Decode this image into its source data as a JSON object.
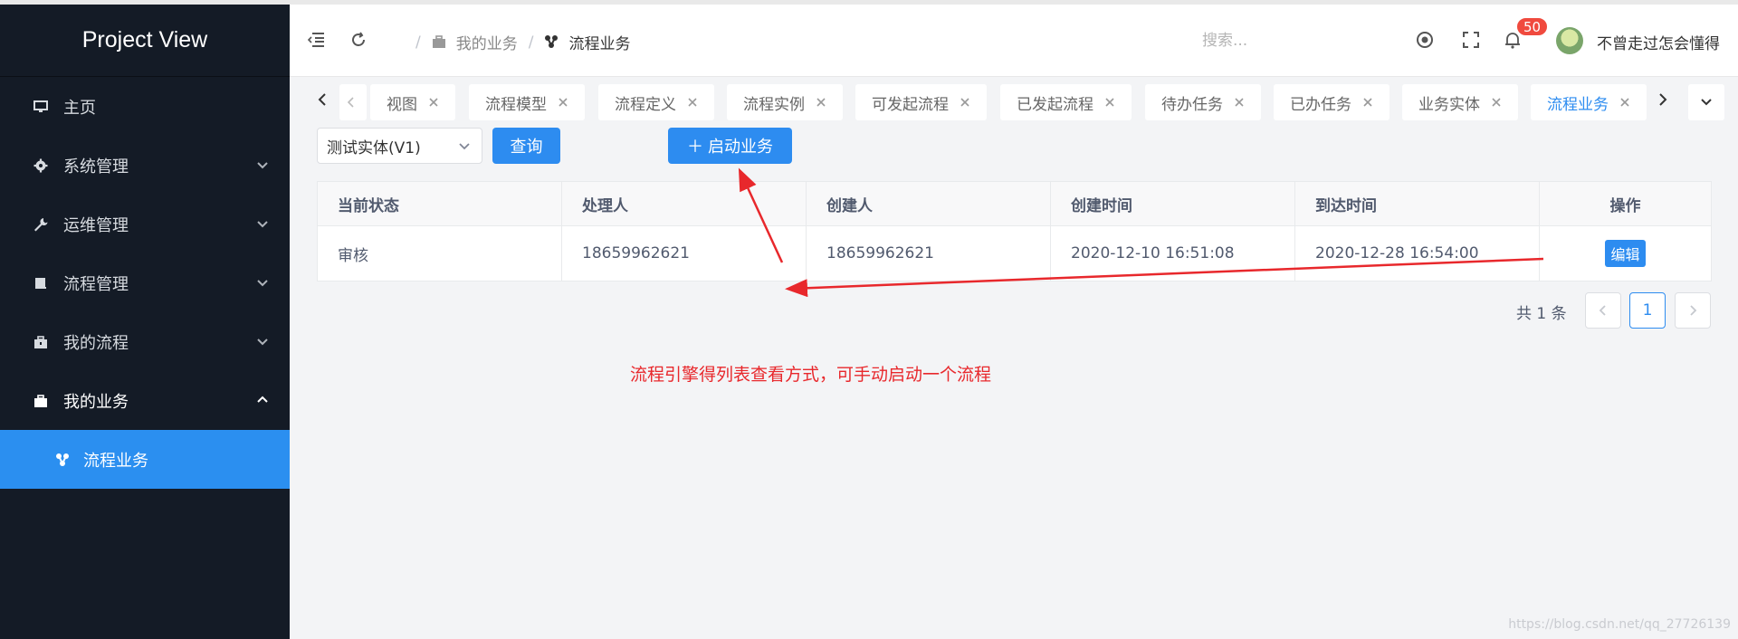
{
  "app": {
    "title": "Project View"
  },
  "sidebar": {
    "items": [
      {
        "label": "主页",
        "icon": "monitor-icon"
      },
      {
        "label": "系统管理",
        "icon": "gear-icon"
      },
      {
        "label": "运维管理",
        "icon": "wrench-icon"
      },
      {
        "label": "流程管理",
        "icon": "book-icon"
      },
      {
        "label": "我的流程",
        "icon": "briefcase-icon"
      },
      {
        "label": "我的业务",
        "icon": "briefcase-icon"
      }
    ],
    "sub_item": {
      "label": "流程业务",
      "icon": "workflow-icon"
    }
  },
  "header": {
    "breadcrumb": [
      "我的业务",
      "流程业务"
    ],
    "search_placeholder": "搜索...",
    "notification_count": "50",
    "username": "不曾走过怎会懂得"
  },
  "tabs": {
    "items": [
      "视图",
      "流程模型",
      "流程定义",
      "流程实例",
      "可发起流程",
      "已发起流程",
      "待办任务",
      "已办任务",
      "业务实体",
      "流程业务"
    ],
    "active": "流程业务"
  },
  "toolbar": {
    "entity_select": "测试实体(V1)",
    "query_label": "查询",
    "start_label": "＋  启动业务"
  },
  "table": {
    "columns": [
      "当前状态",
      "处理人",
      "创建人",
      "创建时间",
      "到达时间",
      "操作"
    ],
    "rows": [
      [
        "审核",
        "18659962621",
        "18659962621",
        "2020-12-10 16:51:08",
        "2020-12-28 16:54:00",
        "编辑"
      ]
    ]
  },
  "pagination": {
    "total_text": "共 1 条",
    "current_page": "1"
  },
  "annotation": {
    "note": "流程引擎得列表查看方式，可手动启动一个流程",
    "color": "#e8282c"
  },
  "watermark": "https://blog.csdn.net/qq_27726139",
  "colors": {
    "sidebar_bg": "#141b26",
    "accent": "#2d8cf0",
    "badge": "#f04a3e"
  }
}
